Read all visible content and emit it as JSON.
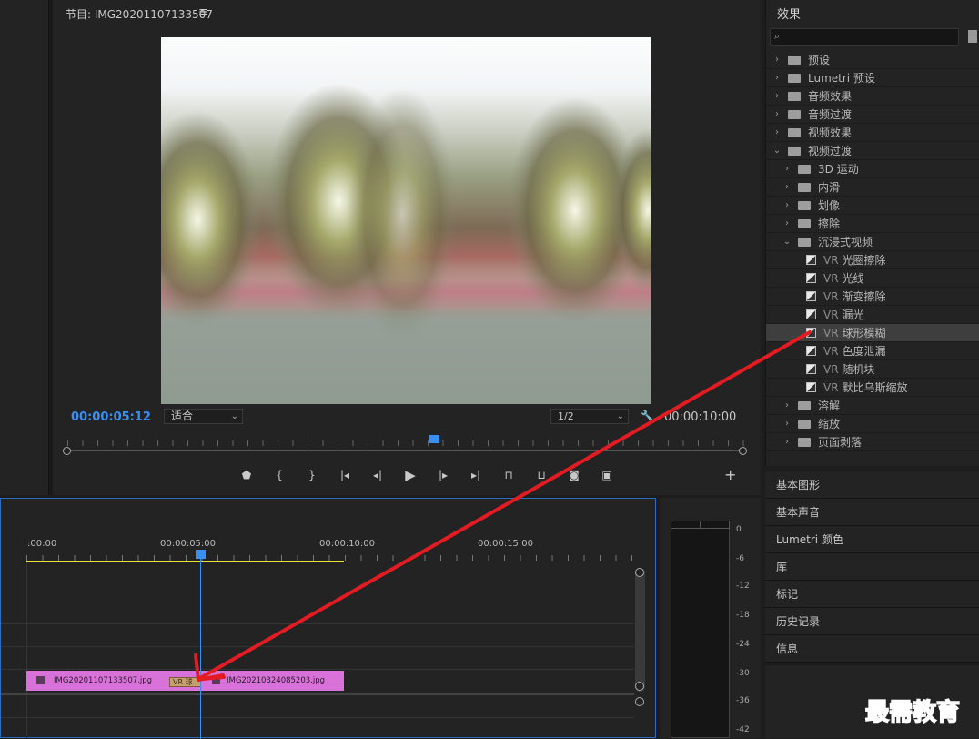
{
  "program": {
    "title": "节目: IMG20201107133507",
    "menu_icon": "hamburger-icon",
    "timecode_current": "00:00:05:12",
    "fit_value": "适合",
    "resolution_value": "1/2",
    "timecode_duration": "00:00:10:00"
  },
  "transport": {
    "buttons": [
      "add-marker-icon",
      "mark-in-icon",
      "mark-out-icon",
      "go-to-in-icon",
      "step-back-icon",
      "play-icon",
      "step-forward-icon",
      "go-to-out-icon",
      "lift-icon",
      "extract-icon",
      "export-frame-icon",
      "compare-icon"
    ],
    "add_label": "+"
  },
  "effects": {
    "title": "效果",
    "items": [
      {
        "label": "预设",
        "level": 0,
        "expanded": false,
        "kind": "folder-star"
      },
      {
        "label": "Lumetri 预设",
        "level": 0,
        "expanded": false,
        "kind": "folder-star"
      },
      {
        "label": "音频效果",
        "level": 0,
        "expanded": false,
        "kind": "folder"
      },
      {
        "label": "音频过渡",
        "level": 0,
        "expanded": false,
        "kind": "folder"
      },
      {
        "label": "视频效果",
        "level": 0,
        "expanded": false,
        "kind": "folder"
      },
      {
        "label": "视频过渡",
        "level": 0,
        "expanded": true,
        "kind": "folder"
      },
      {
        "label": "3D 运动",
        "level": 1,
        "expanded": false,
        "kind": "folder"
      },
      {
        "label": "内滑",
        "level": 1,
        "expanded": false,
        "kind": "folder"
      },
      {
        "label": "划像",
        "level": 1,
        "expanded": false,
        "kind": "folder"
      },
      {
        "label": "擦除",
        "level": 1,
        "expanded": false,
        "kind": "folder"
      },
      {
        "label": "沉浸式视频",
        "level": 1,
        "expanded": true,
        "kind": "folder"
      },
      {
        "prefix": "VR",
        "label": "光圈擦除",
        "level": 2,
        "kind": "transition"
      },
      {
        "prefix": "VR",
        "label": "光线",
        "level": 2,
        "kind": "transition"
      },
      {
        "prefix": "VR",
        "label": "渐变擦除",
        "level": 2,
        "kind": "transition"
      },
      {
        "prefix": "VR",
        "label": "漏光",
        "level": 2,
        "kind": "transition"
      },
      {
        "prefix": "VR",
        "label": "球形模糊",
        "level": 2,
        "kind": "transition",
        "selected": true
      },
      {
        "prefix": "VR",
        "label": "色度泄漏",
        "level": 2,
        "kind": "transition"
      },
      {
        "prefix": "VR",
        "label": "随机块",
        "level": 2,
        "kind": "transition"
      },
      {
        "prefix": "VR",
        "label": "默比乌斯缩放",
        "level": 2,
        "kind": "transition"
      },
      {
        "label": "溶解",
        "level": 1,
        "expanded": false,
        "kind": "folder"
      },
      {
        "label": "缩放",
        "level": 1,
        "expanded": false,
        "kind": "folder"
      },
      {
        "label": "页面剥落",
        "level": 1,
        "expanded": false,
        "kind": "folder"
      }
    ]
  },
  "side_panels": [
    "基本图形",
    "基本声音",
    "Lumetri 颜色",
    "库",
    "标记",
    "历史记录",
    "信息"
  ],
  "timeline": {
    "ruler_labels": [
      ":00:00",
      "00:00:05:00",
      "00:00:10:00",
      "00:00:15:00"
    ],
    "clips": [
      {
        "name": "IMG20201107133507.jpg",
        "color": "#d872d9"
      },
      {
        "name": "IMG20210324085203.jpg",
        "color": "#d872d9"
      }
    ],
    "transition_label": "VR 球"
  },
  "meter": {
    "db_labels": [
      "0",
      "-6",
      "-12",
      "-18",
      "-24",
      "-30",
      "-36",
      "-42"
    ]
  },
  "watermark": "最需教育",
  "colors": {
    "accent_blue": "#3a8ff5",
    "clip_pink": "#d872d9",
    "work_area_yellow": "#e5e32f",
    "annotation_red": "#e21c22"
  }
}
